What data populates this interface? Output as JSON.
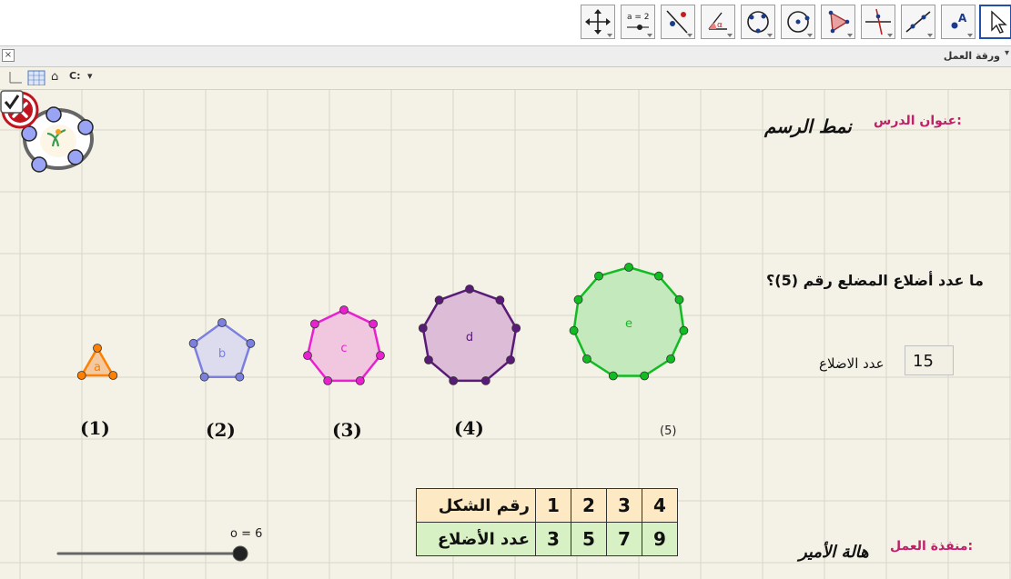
{
  "toolbar": {
    "tools": [
      {
        "name": "move-graphics-view",
        "icon": "move-arrows-icon"
      },
      {
        "name": "slider",
        "icon": "slider-icon",
        "label": "a = 2"
      },
      {
        "name": "reflect",
        "icon": "reflect-icon"
      },
      {
        "name": "angle",
        "icon": "angle-icon",
        "label": "α"
      },
      {
        "name": "circle-three-points",
        "icon": "circle-three-points-icon"
      },
      {
        "name": "circle-center-point",
        "icon": "circle-center-icon"
      },
      {
        "name": "polygon",
        "icon": "polygon-icon"
      },
      {
        "name": "perpendicular-line",
        "icon": "perpendicular-line-icon"
      },
      {
        "name": "line",
        "icon": "line-icon"
      },
      {
        "name": "point",
        "icon": "point-icon",
        "label": "A"
      },
      {
        "name": "select",
        "icon": "cursor-arrow-icon"
      }
    ]
  },
  "view": {
    "title": "ورقة العمل",
    "close_label": "×",
    "menu_label": "▾"
  },
  "graphics_bar": {
    "home_label": "⌂",
    "undo_label": "C:",
    "menu_label": "▾"
  },
  "lesson": {
    "label": "عنوان الدرس:",
    "title": "نمط الرسم"
  },
  "question": "ما عدد أضلاع المضلع رقم (5)؟",
  "answer": {
    "label": "عدد الاضلاع",
    "value": "15",
    "status": "wrong",
    "status_color": "#c0141e"
  },
  "polygons": [
    {
      "number_label": "(1)",
      "letter": "a",
      "sides": 3,
      "color": "#ff7f00",
      "fill": "#f3c9a0"
    },
    {
      "number_label": "(2)",
      "letter": "b",
      "sides": 5,
      "color": "#7a7fe0",
      "fill": "#dcdcee"
    },
    {
      "number_label": "(3)",
      "letter": "c",
      "sides": 7,
      "color": "#e820d0",
      "fill": "#f1c6df"
    },
    {
      "number_label": "(4)",
      "letter": "d",
      "sides": 9,
      "color": "#5a1a78",
      "fill": "#dcbcd6"
    },
    {
      "number_label": "",
      "letter": "e",
      "sides": 11,
      "color": "#11bb22",
      "fill": "#c4e9bd"
    }
  ],
  "checkbox": {
    "label": "(5)",
    "checked": true
  },
  "table": {
    "row_shape": {
      "header": "رقم الشكل",
      "values": [
        "1",
        "2",
        "3",
        "4"
      ]
    },
    "row_sides": {
      "header": "عدد الأضلاع",
      "values": [
        "3",
        "5",
        "7",
        "9"
      ]
    }
  },
  "slider": {
    "label": "o = 6",
    "value": 6,
    "fraction": 1.0
  },
  "author": {
    "label": "منفذة العمل:",
    "name": "هالة الأمير"
  }
}
